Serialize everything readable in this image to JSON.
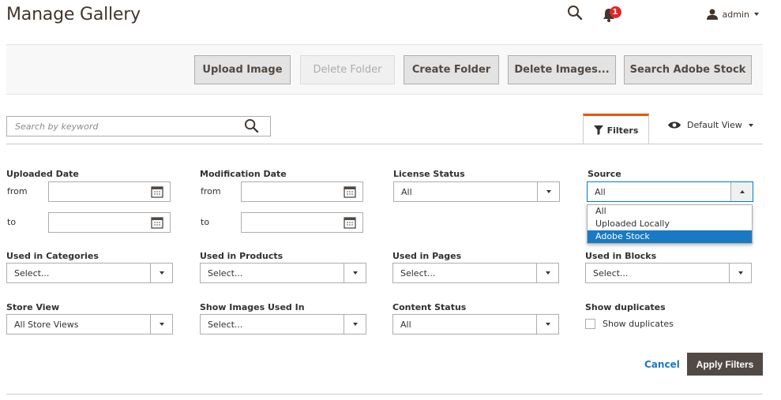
{
  "page": {
    "title": "Manage Gallery"
  },
  "header": {
    "notification_count": "1",
    "user": "admin"
  },
  "toolbar": {
    "upload_image": "Upload Image",
    "delete_folder": "Delete Folder",
    "create_folder": "Create Folder",
    "delete_images": "Delete Images...",
    "search_adobe_stock": "Search Adobe Stock"
  },
  "search": {
    "placeholder": "Search by keyword"
  },
  "tabs": {
    "filters": "Filters",
    "default_view": "Default View"
  },
  "filters": {
    "uploaded_date": {
      "label": "Uploaded Date",
      "from": "from",
      "to": "to"
    },
    "modification_date": {
      "label": "Modification Date",
      "from": "from",
      "to": "to"
    },
    "license_status": {
      "label": "License Status",
      "value": "All"
    },
    "source": {
      "label": "Source",
      "value": "All",
      "options": [
        "All",
        "Uploaded Locally",
        "Adobe Stock"
      ],
      "highlighted": "Adobe Stock"
    },
    "used_in_categories": {
      "label": "Used in Categories",
      "value": "Select..."
    },
    "used_in_products": {
      "label": "Used in Products",
      "value": "Select..."
    },
    "used_in_pages": {
      "label": "Used in Pages",
      "value": "Select..."
    },
    "used_in_blocks": {
      "label": "Used in Blocks",
      "value": "Select..."
    },
    "store_view": {
      "label": "Store View",
      "value": "All Store Views"
    },
    "show_images_used_in": {
      "label": "Show Images Used In",
      "value": "Select..."
    },
    "content_status": {
      "label": "Content Status",
      "value": "All"
    },
    "show_duplicates": {
      "label": "Show duplicates",
      "checkbox_label": "Show duplicates",
      "checked": false
    }
  },
  "actions": {
    "cancel": "Cancel",
    "apply": "Apply Filters"
  },
  "colors": {
    "accent": "#eb5202",
    "link": "#1979c3",
    "primary_button": "#514943",
    "badge": "#e22626"
  }
}
